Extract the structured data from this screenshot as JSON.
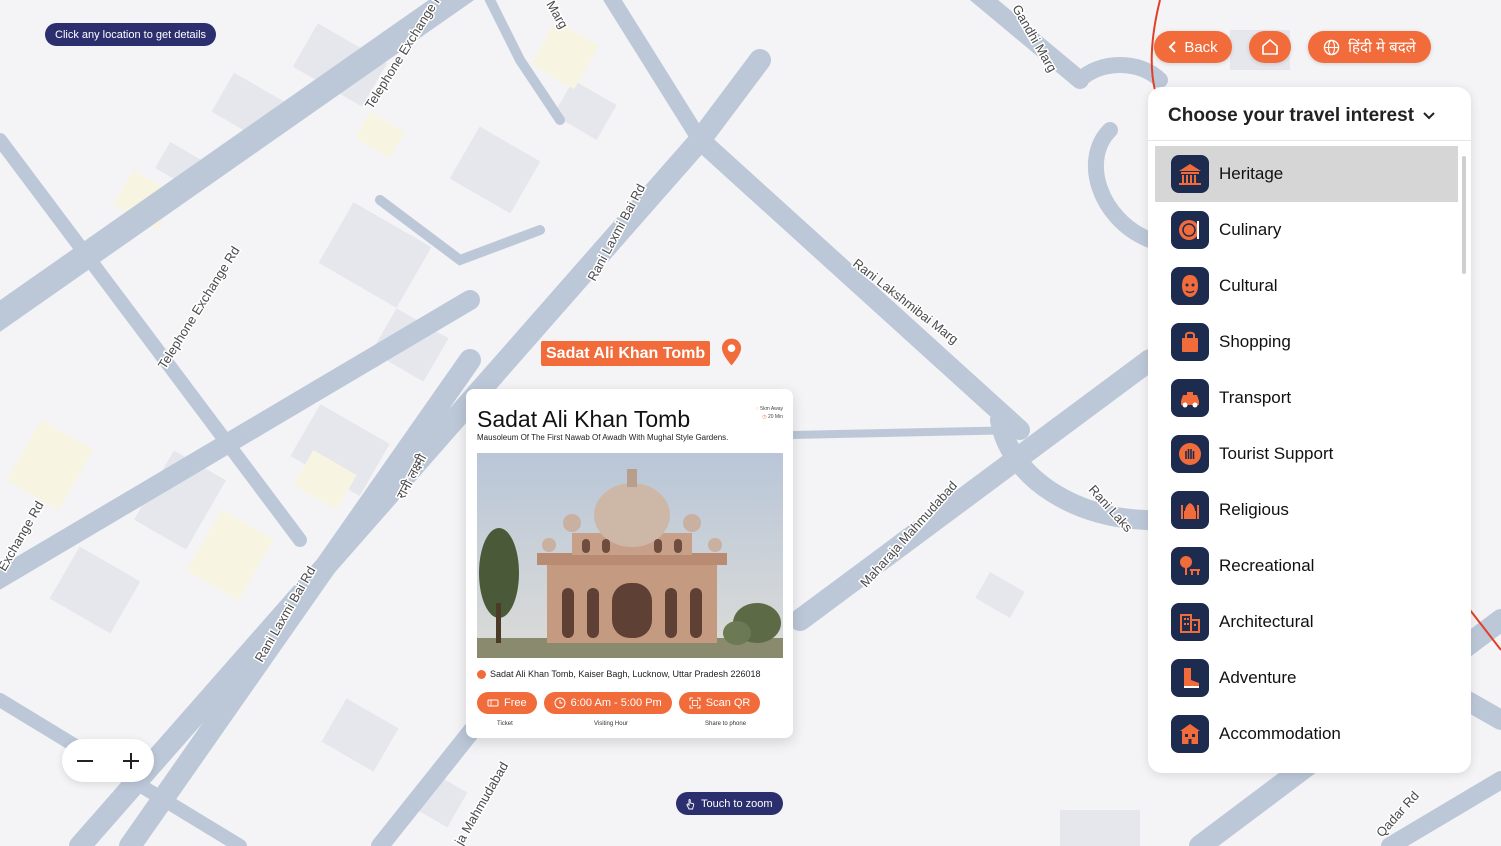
{
  "map": {
    "hint": "Click any location to get details",
    "touch_zoom": "Touch to zoom",
    "roads": [
      "Telephone Exchange Rd",
      "Rani Laxmi Bai Rd",
      "Rani Lakshmibai Marg",
      "Maharaja Mahmudabad",
      "Telephone Exchange Rd",
      "Gandhi Marg",
      "Exchange Rd",
      "Rani Laxmi Bai Rd",
      "Rani Laks",
      "Qadar Rd",
      "Marg",
      "रानी लक्ष्मी",
      "ja Mahmudabad"
    ]
  },
  "marker": {
    "label": "Sadat Ali Khan Tomb"
  },
  "card": {
    "title": "Sadat Ali Khan Tomb",
    "subtitle": "Mausoleum Of The First Nawab Of Awadh With Mughal Style Gardens.",
    "distance": "5km Away",
    "duration": "20 Min",
    "address": "Sadat Ali Khan Tomb, Kaiser Bagh, Lucknow, Uttar Pradesh 226018",
    "ticket": {
      "label": "Free",
      "caption": "Ticket"
    },
    "hours": {
      "label": "6:00 Am - 5:00 Pm",
      "caption": "Visiting Hour"
    },
    "qr": {
      "label": "Scan QR",
      "caption": "Share to phone"
    }
  },
  "topbar": {
    "back": "Back",
    "home_icon": "home-icon",
    "language": "हिंदी मे बदले"
  },
  "panel": {
    "title": "Choose your travel interest",
    "items": [
      {
        "label": "Heritage",
        "icon": "heritage-icon"
      },
      {
        "label": "Culinary",
        "icon": "culinary-icon"
      },
      {
        "label": "Cultural",
        "icon": "cultural-icon"
      },
      {
        "label": "Shopping",
        "icon": "shopping-icon"
      },
      {
        "label": "Transport",
        "icon": "transport-icon"
      },
      {
        "label": "Tourist Support",
        "icon": "tourist-support-icon"
      },
      {
        "label": "Religious",
        "icon": "religious-icon"
      },
      {
        "label": "Recreational",
        "icon": "recreational-icon"
      },
      {
        "label": "Architectural",
        "icon": "architectural-icon"
      },
      {
        "label": "Adventure",
        "icon": "adventure-icon"
      },
      {
        "label": "Accommodation",
        "icon": "accommodation-icon"
      }
    ]
  },
  "colors": {
    "accent": "#f26b3a",
    "navy": "#2c2f6e",
    "icon_bg": "#1d2b4f",
    "road": "#bcc8d8",
    "active_row": "#d6d6d6"
  }
}
